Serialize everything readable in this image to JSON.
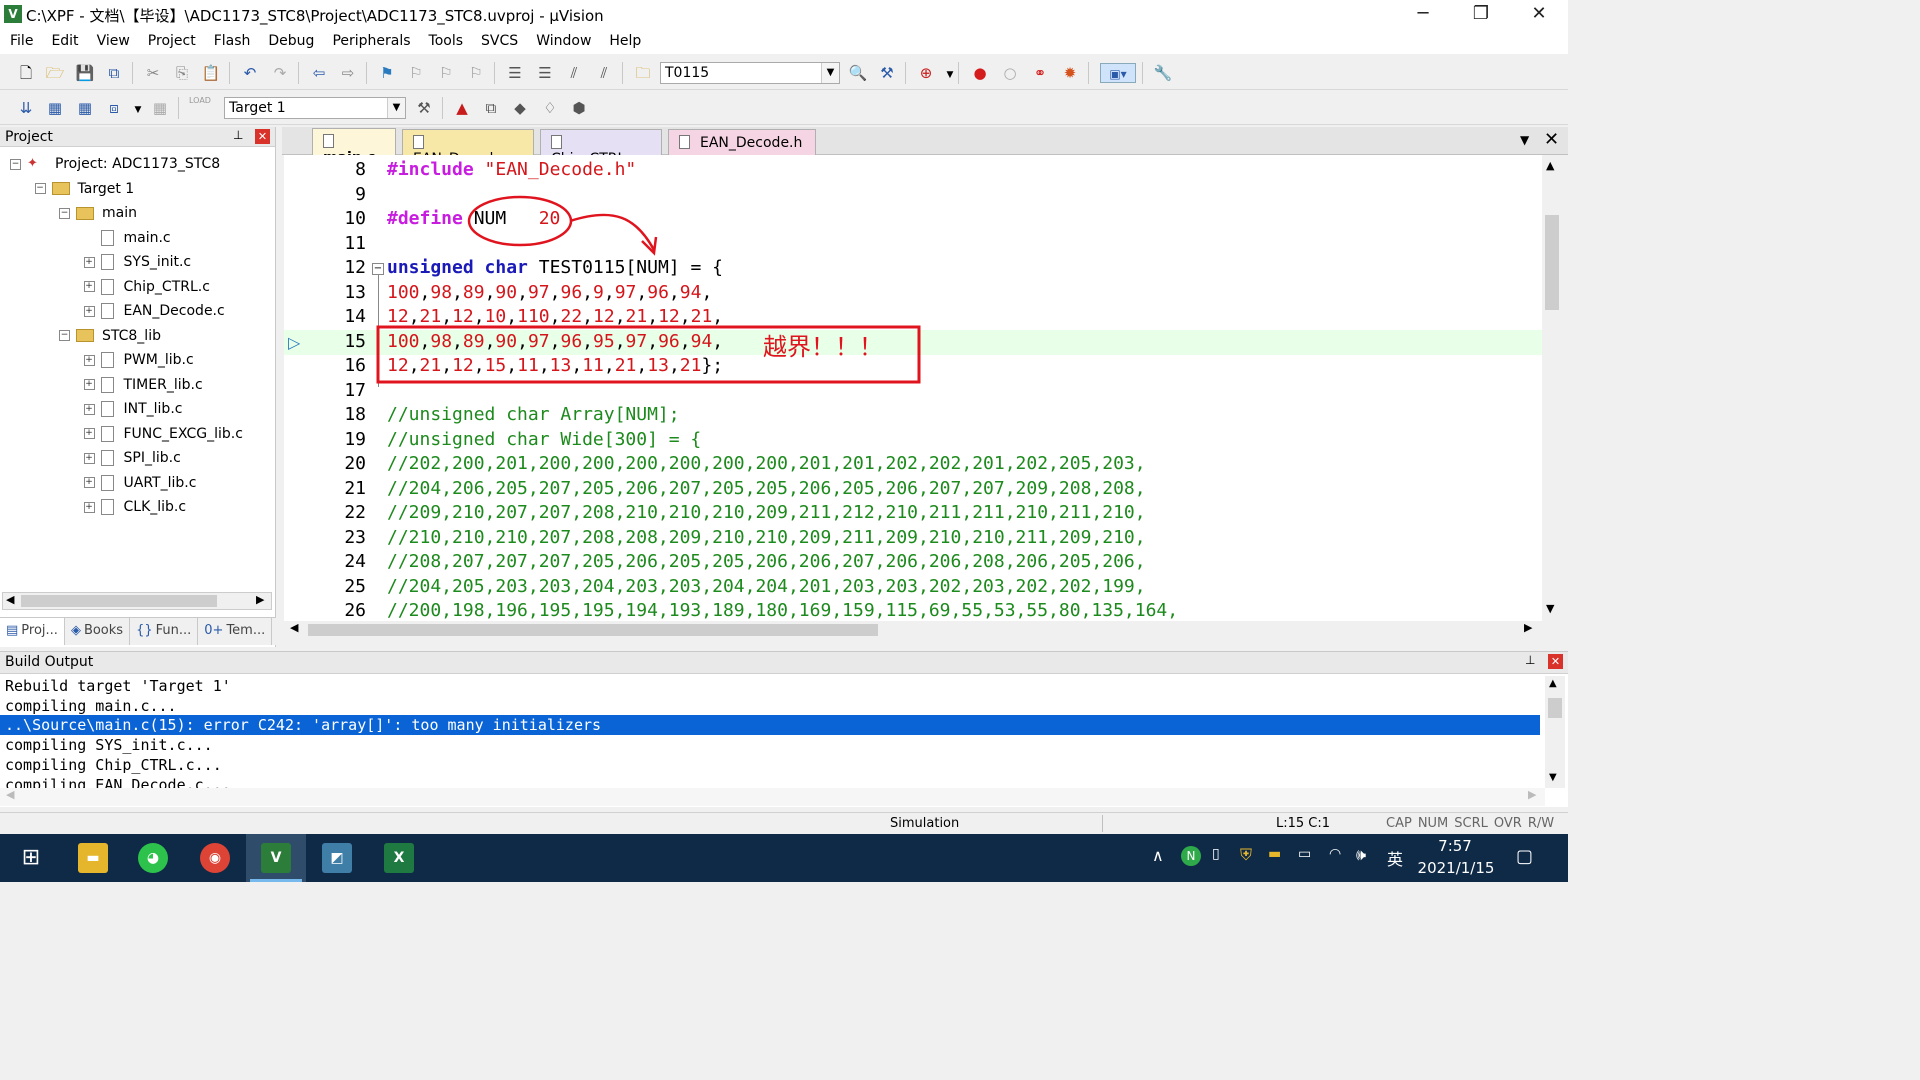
{
  "window": {
    "title": "C:\\XPF - 文档\\【毕设】\\ADC1173_STC8\\Project\\ADC1173_STC8.uvproj - µVision",
    "icon": "uvision-icon",
    "app_icon_letter": "V"
  },
  "menu": [
    "File",
    "Edit",
    "View",
    "Project",
    "Flash",
    "Debug",
    "Peripherals",
    "Tools",
    "SVCS",
    "Window",
    "Help"
  ],
  "toolbar1": {
    "find_combo": "T0115"
  },
  "toolbar2": {
    "target_combo": "Target 1",
    "load_label": "LOAD"
  },
  "project_panel": {
    "title": "Project",
    "items": [
      {
        "label": "Project: ADC1173_STC8",
        "level": 0,
        "kind": "project",
        "expander": "−"
      },
      {
        "label": "Target 1",
        "level": 1,
        "kind": "folder",
        "expander": "−"
      },
      {
        "label": "main",
        "level": 2,
        "kind": "folder",
        "expander": "−"
      },
      {
        "label": "main.c",
        "level": 3,
        "kind": "file",
        "expander": ""
      },
      {
        "label": "SYS_init.c",
        "level": 3,
        "kind": "file",
        "expander": "+"
      },
      {
        "label": "Chip_CTRL.c",
        "level": 3,
        "kind": "file",
        "expander": "+"
      },
      {
        "label": "EAN_Decode.c",
        "level": 3,
        "kind": "file",
        "expander": "+"
      },
      {
        "label": "STC8_lib",
        "level": 2,
        "kind": "folder",
        "expander": "−"
      },
      {
        "label": "PWM_lib.c",
        "level": 3,
        "kind": "file",
        "expander": "+"
      },
      {
        "label": "TIMER_lib.c",
        "level": 3,
        "kind": "file",
        "expander": "+"
      },
      {
        "label": "INT_lib.c",
        "level": 3,
        "kind": "file",
        "expander": "+"
      },
      {
        "label": "FUNC_EXCG_lib.c",
        "level": 3,
        "kind": "file",
        "expander": "+"
      },
      {
        "label": "SPI_lib.c",
        "level": 3,
        "kind": "file",
        "expander": "+"
      },
      {
        "label": "UART_lib.c",
        "level": 3,
        "kind": "file",
        "expander": "+"
      },
      {
        "label": "CLK_lib.c",
        "level": 3,
        "kind": "file",
        "expander": "+"
      }
    ],
    "bottom_tabs": [
      {
        "label": "Proj...",
        "icon": "project-tab-icon",
        "glyph": "▤"
      },
      {
        "label": "Books",
        "icon": "books-tab-icon",
        "glyph": "◈"
      },
      {
        "label": "Fun...",
        "icon": "functions-tab-icon",
        "glyph": "{}"
      },
      {
        "label": "Tem...",
        "icon": "templates-tab-icon",
        "glyph": "0+"
      }
    ]
  },
  "editor": {
    "tabs": [
      {
        "label": "main.c",
        "active": true,
        "bg": "#fdf6d8"
      },
      {
        "label": "EAN_Decode.c",
        "active": false,
        "bg": "#f7e8a8"
      },
      {
        "label": "Chip_CTRL.c",
        "active": false,
        "bg": "#e6e0f5"
      },
      {
        "label": "EAN_Decode.h",
        "active": false,
        "bg": "#f5d5e3"
      }
    ],
    "lines": [
      {
        "n": "8",
        "html": "<span class=\"kw\">#include</span> <span class=\"str\">\"EAN_Decode.h\"</span>"
      },
      {
        "n": "9",
        "html": ""
      },
      {
        "n": "10",
        "html": "<span class=\"kw\">#define</span> NUM   <span class=\"num\">20</span>"
      },
      {
        "n": "11",
        "html": ""
      },
      {
        "n": "12",
        "html": "<span class=\"kw2\">unsigned</span> <span class=\"kw2\">char</span> TEST0115[NUM] = {"
      },
      {
        "n": "13",
        "html": "<span class=\"num\">100</span>,<span class=\"num\">98</span>,<span class=\"num\">89</span>,<span class=\"num\">90</span>,<span class=\"num\">97</span>,<span class=\"num\">96</span>,<span class=\"num\">9</span>,<span class=\"num\">97</span>,<span class=\"num\">96</span>,<span class=\"num\">94</span>,"
      },
      {
        "n": "14",
        "html": "<span class=\"num\">12</span>,<span class=\"num\">21</span>,<span class=\"num\">12</span>,<span class=\"num\">10</span>,<span class=\"num\">110</span>,<span class=\"num\">22</span>,<span class=\"num\">12</span>,<span class=\"num\">21</span>,<span class=\"num\">12</span>,<span class=\"num\">21</span>,"
      },
      {
        "n": "15",
        "html": "<span class=\"num\">100</span>,<span class=\"num\">98</span>,<span class=\"num\">89</span>,<span class=\"num\">90</span>,<span class=\"num\">97</span>,<span class=\"num\">96</span>,<span class=\"num\">95</span>,<span class=\"num\">97</span>,<span class=\"num\">96</span>,<span class=\"num\">94</span>,"
      },
      {
        "n": "16",
        "html": "<span class=\"num\">12</span>,<span class=\"num\">21</span>,<span class=\"num\">12</span>,<span class=\"num\">15</span>,<span class=\"num\">11</span>,<span class=\"num\">13</span>,<span class=\"num\">11</span>,<span class=\"num\">21</span>,<span class=\"num\">13</span>,<span class=\"num\">21</span>};"
      },
      {
        "n": "17",
        "html": ""
      },
      {
        "n": "18",
        "html": "<span class=\"cmt\">//unsigned char Array[NUM];</span>"
      },
      {
        "n": "19",
        "html": "<span class=\"cmt\">//unsigned char Wide[300] = {</span>"
      },
      {
        "n": "20",
        "html": "<span class=\"cmt\">//202,200,201,200,200,200,200,200,200,201,201,202,202,201,202,205,203,</span>"
      },
      {
        "n": "21",
        "html": "<span class=\"cmt\">//204,206,205,207,205,206,207,205,205,206,205,206,207,207,209,208,208,</span>"
      },
      {
        "n": "22",
        "html": "<span class=\"cmt\">//209,210,207,207,208,210,210,210,209,211,212,210,211,211,210,211,210,</span>"
      },
      {
        "n": "23",
        "html": "<span class=\"cmt\">//210,210,210,207,208,208,209,210,210,209,211,209,210,210,211,209,210,</span>"
      },
      {
        "n": "24",
        "html": "<span class=\"cmt\">//208,207,207,207,205,206,205,205,206,206,207,206,206,208,206,205,206,</span>"
      },
      {
        "n": "25",
        "html": "<span class=\"cmt\">//204,205,203,203,204,203,203,204,204,201,203,203,202,203,202,202,199,</span>"
      },
      {
        "n": "26",
        "html": "<span class=\"cmt\">//200,198,196,195,195,194,193,189,180,169,159,115,69,55,53,55,80,135,164,</span>"
      }
    ],
    "annotation": "越界！！！"
  },
  "build_output": {
    "title": "Build Output",
    "lines": [
      {
        "text": "Rebuild target 'Target 1'",
        "selected": false
      },
      {
        "text": "compiling main.c...",
        "selected": false
      },
      {
        "text": "..\\Source\\main.c(15): error C242: 'array[]': too many initializers",
        "selected": true
      },
      {
        "text": "compiling SYS_init.c...",
        "selected": false
      },
      {
        "text": "compiling Chip_CTRL.c...",
        "selected": false
      },
      {
        "text": "compiling EAN_Decode.c...",
        "selected": false
      }
    ]
  },
  "status": {
    "mode": "Simulation",
    "cursor": "L:15 C:1",
    "flags": [
      "CAP",
      "NUM",
      "SCRL",
      "OVR",
      "R/W"
    ]
  },
  "taskbar": {
    "time": "7:57",
    "date": "2021/1/15",
    "ime": "英"
  },
  "colors": {
    "accent": "#0078d7",
    "selection": "#0a64d6",
    "error_box": "#e0141e",
    "annotation_red": "#e0141e",
    "current_line": "#e8ffe8"
  }
}
